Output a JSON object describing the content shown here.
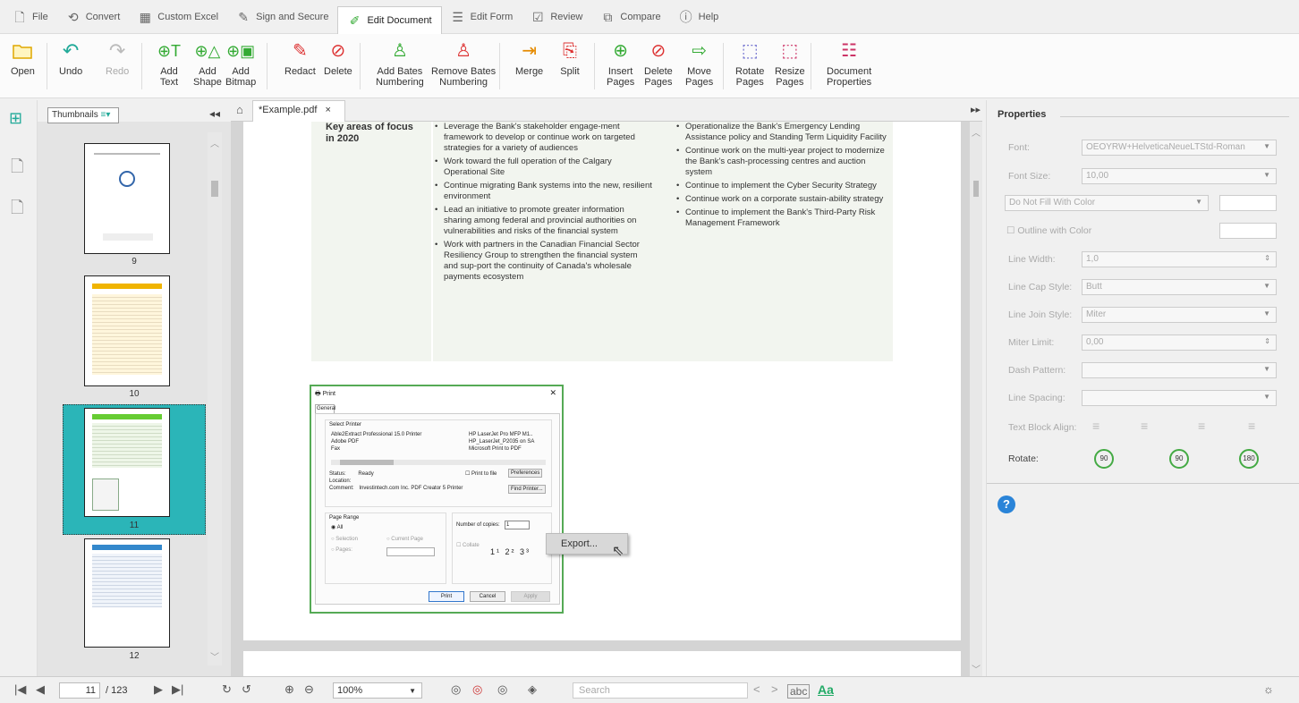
{
  "menu": {
    "items": [
      {
        "label": "File",
        "icon": "file-icon"
      },
      {
        "label": "Convert",
        "icon": "convert-icon"
      },
      {
        "label": "Custom Excel",
        "icon": "table-icon"
      },
      {
        "label": "Sign and Secure",
        "icon": "pen-icon"
      },
      {
        "label": "Edit Document",
        "icon": "edit-icon",
        "active": true
      },
      {
        "label": "Edit Form",
        "icon": "form-icon"
      },
      {
        "label": "Review",
        "icon": "review-icon"
      },
      {
        "label": "Compare",
        "icon": "compare-icon"
      },
      {
        "label": "Help",
        "icon": "help-icon"
      }
    ]
  },
  "toolbar": {
    "open": "Open",
    "undo": "Undo",
    "redo": "Redo",
    "add_text": [
      "Add",
      "Text"
    ],
    "add_shape": [
      "Add",
      "Shape"
    ],
    "add_bitmap": [
      "Add",
      "Bitmap"
    ],
    "redact": "Redact",
    "delete": "Delete",
    "add_bates": [
      "Add Bates",
      "Numbering"
    ],
    "remove_bates": [
      "Remove Bates",
      "Numbering"
    ],
    "merge": "Merge",
    "split": "Split",
    "insert_pages": [
      "Insert",
      "Pages"
    ],
    "delete_pages": [
      "Delete",
      "Pages"
    ],
    "move_pages": [
      "Move",
      "Pages"
    ],
    "rotate_pages": [
      "Rotate",
      "Pages"
    ],
    "resize_pages": [
      "Resize",
      "Pages"
    ],
    "doc_props": [
      "Document",
      "Properties"
    ]
  },
  "thumbnails": {
    "selector": "Thumbnails",
    "pages": [
      "9",
      "10",
      "11",
      "12"
    ],
    "selected": "11"
  },
  "tab": {
    "name": "*Example.pdf",
    "close": "×"
  },
  "document": {
    "key_areas": "Key areas of focus in 2020",
    "col1": [
      "Leverage the Bank's stakeholder engage-ment framework to develop or continue work on targeted strategies for a variety of audiences",
      "Work toward the full operation of the Calgary Operational Site",
      "Continue migrating Bank systems into the new, resilient environment",
      "Lead an initiative to promote greater information sharing among federal and provincial authorities on vulnerabilities and risks of the financial system",
      "Work with partners in the Canadian Financial Sector Resiliency Group to strengthen the financial system and sup-port the continuity of Canada's wholesale payments ecosystem"
    ],
    "col2": [
      "Operationalize the Bank's Emergency Lending Assistance policy and Standing Term Liquidity Facility",
      "Continue work on the multi-year project to modernize the Bank's cash-processing centres and auction system",
      "Continue to implement the Cyber Security Strategy",
      "Continue work on a corporate sustain-ability strategy",
      "Continue to implement the Bank's Third-Party Risk Management Framework"
    ]
  },
  "print_dialog": {
    "title": "Print",
    "tab": "General",
    "select_printer": "Select Printer",
    "printers_left": [
      "Able2Extract Professional 15.0 Printer",
      "Adobe PDF",
      "Fax"
    ],
    "printers_right": [
      "HP LaserJet Pro MFP M1..",
      "HP_LaserJet_P2035 on SA",
      "Microsoft Print to PDF"
    ],
    "status_label": "Status:",
    "status_value": "Ready",
    "location_label": "Location:",
    "comment_label": "Comment:",
    "comment_value": "Investintech.com Inc. PDF Creator 5 Printer",
    "print_to_file": "Print to file",
    "preferences": "Preferences",
    "find_printer": "Find Printer...",
    "page_range": "Page Range",
    "all": "All",
    "selection": "Selection",
    "current_page": "Current Page",
    "pages": "Pages:",
    "copies_label": "Number of copies:",
    "copies": "1",
    "collate": "Collate",
    "print": "Print",
    "cancel": "Cancel",
    "apply": "Apply"
  },
  "context_menu": {
    "export": "Export..."
  },
  "properties": {
    "title": "Properties",
    "font_label": "Font:",
    "font": "OEOYRW+HelveticaNeueLTStd-Roman",
    "font_size_label": "Font Size:",
    "font_size": "10,00",
    "fill": "Do Not Fill With Color",
    "outline": "Outline with Color",
    "line_width_label": "Line Width:",
    "line_width": "1,0",
    "line_cap_label": "Line Cap Style:",
    "line_cap": "Butt",
    "line_join_label": "Line Join Style:",
    "line_join": "Miter",
    "miter_label": "Miter Limit:",
    "miter": "0,00",
    "dash_label": "Dash Pattern:",
    "spacing_label": "Line Spacing:",
    "align_label": "Text Block Align:",
    "rotate_label": "Rotate:",
    "rotate_values": [
      "90",
      "90",
      "180"
    ]
  },
  "status": {
    "page": "11",
    "total": "/ 123",
    "zoom": "100%",
    "search_placeholder": "Search",
    "abc": "abc",
    "aa": "Aa"
  }
}
